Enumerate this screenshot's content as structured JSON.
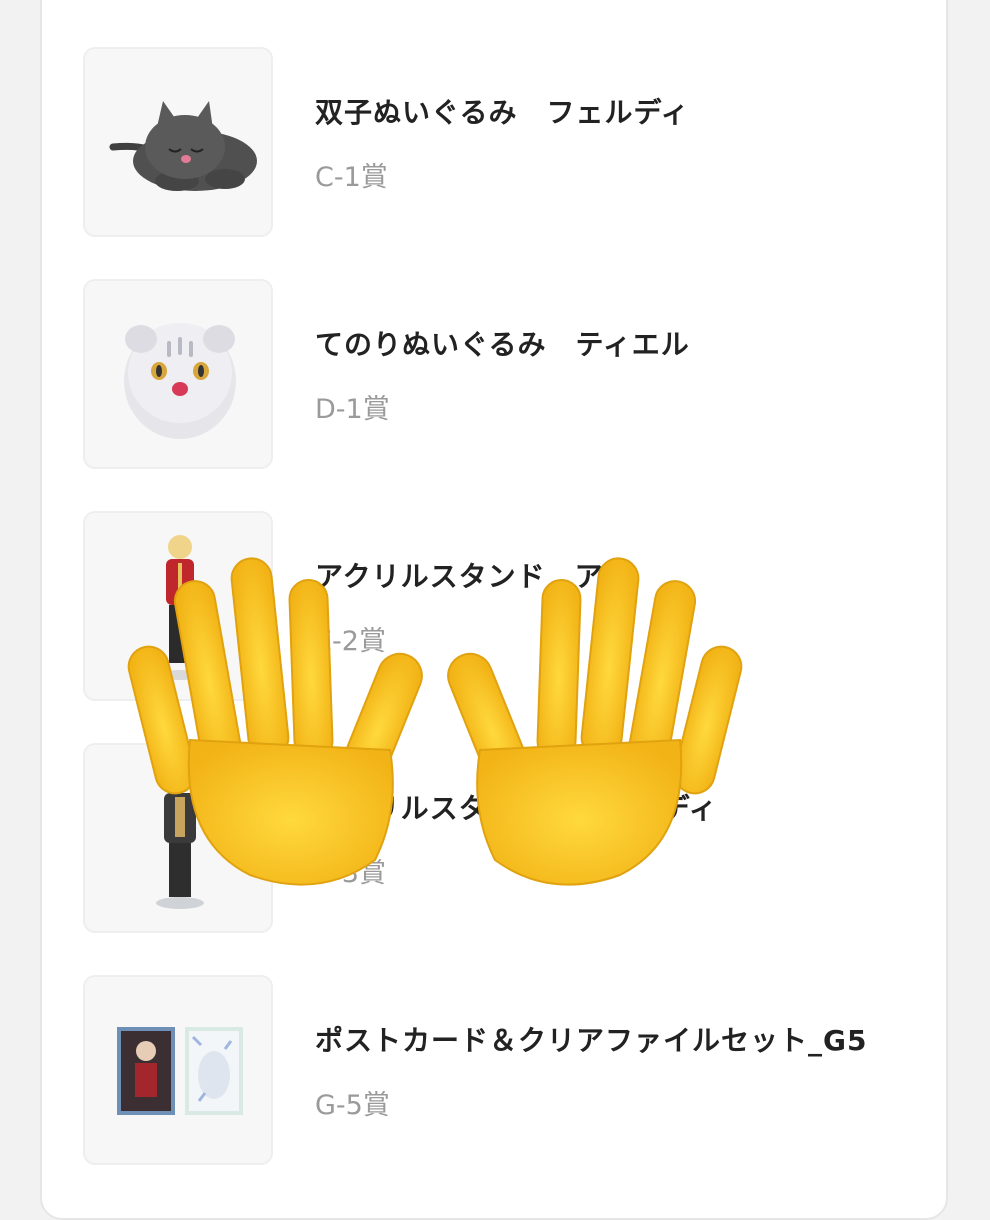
{
  "prizes": [
    {
      "title": "双子ぬいぐるみ　フェルディ",
      "rank": "C-1賞",
      "image": "gray-cat-plush"
    },
    {
      "title": "てのりぬいぐるみ　ティエル",
      "rank": "D-1賞",
      "image": "white-tiger-plush"
    },
    {
      "title": "アクリルスタンド　アン",
      "rank": "E-2賞",
      "image": "acrylic-stand-red-uniform"
    },
    {
      "title": "アクリルスタンド　フェルディ",
      "rank": "E-3賞",
      "image": "acrylic-stand-dark-coat"
    },
    {
      "title": "ポストカード＆クリアファイルセット_G5",
      "rank": "G-5賞",
      "image": "postcard-clear-file-set"
    }
  ],
  "overlay": {
    "icon": "raised-hands-emoji",
    "color": "#f9c623"
  }
}
